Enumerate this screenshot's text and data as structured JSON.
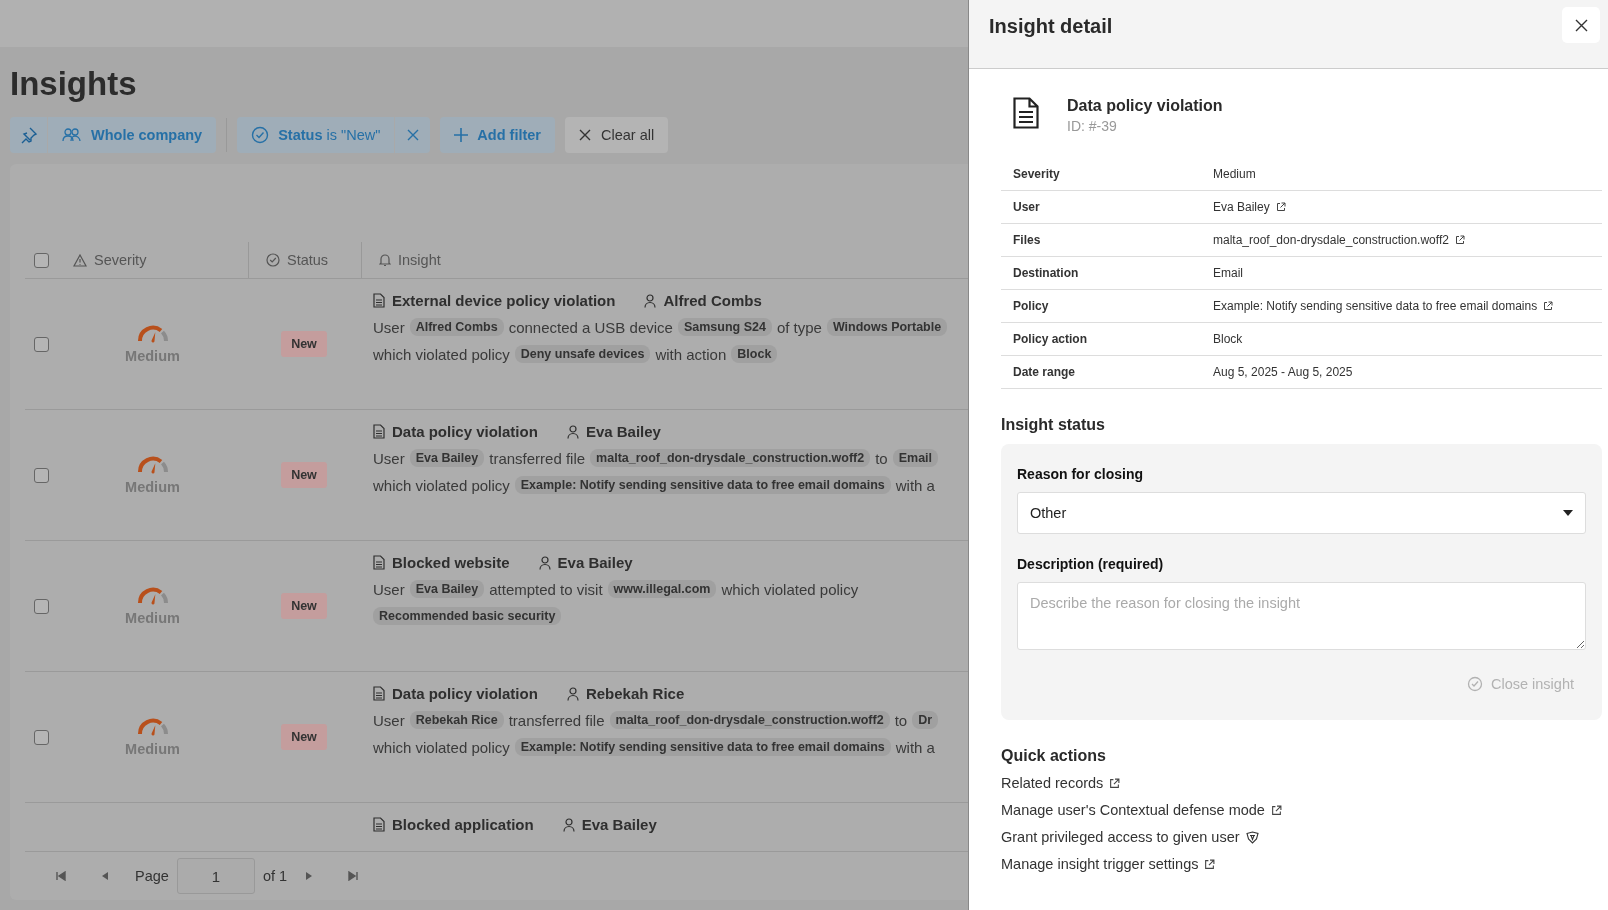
{
  "page_title": "Insights",
  "filter_bar": {
    "pinned": true,
    "scope": "Whole company",
    "status_filter": "**Status** is \"New\"",
    "add_filter": "Add filter",
    "clear_all": "Clear all"
  },
  "table": {
    "all_selected": false,
    "columns": [
      "Severity",
      "Status",
      "Insight"
    ],
    "rows": [
      {
        "selected": false,
        "severity": "Medium",
        "status": "New",
        "title": "External device policy violation",
        "user": "Alfred Combs",
        "lines": [
          [
            {
              "kind": "text",
              "text": "User"
            },
            {
              "kind": "chip",
              "text": "Alfred Combs"
            },
            {
              "kind": "text",
              "text": "connected a USB device"
            },
            {
              "kind": "chip",
              "text": "Samsung S24"
            },
            {
              "kind": "text",
              "text": "of type"
            },
            {
              "kind": "chip",
              "text": "Windows Portable"
            }
          ],
          [
            {
              "kind": "text",
              "text": "which violated policy"
            },
            {
              "kind": "chip",
              "text": "Deny unsafe devices"
            },
            {
              "kind": "text",
              "text": "with action"
            },
            {
              "kind": "chip",
              "text": "Block"
            }
          ]
        ]
      },
      {
        "selected": false,
        "severity": "Medium",
        "status": "New",
        "title": "Data policy violation",
        "user": "Eva Bailey",
        "lines": [
          [
            {
              "kind": "text",
              "text": "User"
            },
            {
              "kind": "chip",
              "text": "Eva Bailey"
            },
            {
              "kind": "text",
              "text": "transferred file"
            },
            {
              "kind": "chip",
              "text": "malta_roof_don-drysdale_construction.woff2"
            },
            {
              "kind": "text",
              "text": "to"
            },
            {
              "kind": "chip",
              "text": "Email"
            }
          ],
          [
            {
              "kind": "text",
              "text": "which violated policy"
            },
            {
              "kind": "chip",
              "text": "Example: Notify sending sensitive data to free email domains"
            },
            {
              "kind": "text",
              "text": "with a"
            }
          ]
        ]
      },
      {
        "selected": false,
        "severity": "Medium",
        "status": "New",
        "title": "Blocked website",
        "user": "Eva Bailey",
        "lines": [
          [
            {
              "kind": "text",
              "text": "User"
            },
            {
              "kind": "chip",
              "text": "Eva Bailey"
            },
            {
              "kind": "text",
              "text": "attempted to visit"
            },
            {
              "kind": "chip",
              "text": "www.illegal.com"
            },
            {
              "kind": "text",
              "text": "which violated policy"
            }
          ],
          [
            {
              "kind": "chip",
              "text": "Recommended basic security"
            }
          ]
        ]
      },
      {
        "selected": false,
        "severity": "Medium",
        "status": "New",
        "title": "Data policy violation",
        "user": "Rebekah Rice",
        "lines": [
          [
            {
              "kind": "text",
              "text": "User"
            },
            {
              "kind": "chip",
              "text": "Rebekah Rice"
            },
            {
              "kind": "text",
              "text": "transferred file"
            },
            {
              "kind": "chip",
              "text": "malta_roof_don-drysdale_construction.woff2"
            },
            {
              "kind": "text",
              "text": "to"
            },
            {
              "kind": "chip",
              "text": "Dr"
            }
          ],
          [
            {
              "kind": "text",
              "text": "which violated policy"
            },
            {
              "kind": "chip",
              "text": "Example: Notify sending sensitive data to free email domains"
            },
            {
              "kind": "text",
              "text": "with a"
            }
          ]
        ]
      }
    ],
    "partial_row": {
      "title": "Blocked application",
      "user": "Eva Bailey"
    }
  },
  "pagination": {
    "page_label": "Page",
    "page": "1",
    "of": "of 1"
  },
  "panel": {
    "title": "Insight detail",
    "insight": {
      "title": "Data policy violation",
      "id": "ID: #-39"
    },
    "details": [
      {
        "label": "Severity",
        "value": "Medium",
        "link": false
      },
      {
        "label": "User",
        "value": "Eva Bailey",
        "link": true
      },
      {
        "label": "Files",
        "value": "malta_roof_don-drysdale_construction.woff2",
        "link": true
      },
      {
        "label": "Destination",
        "value": "Email",
        "link": false
      },
      {
        "label": "Policy",
        "value": "Example: Notify sending sensitive data to free email domains",
        "link": true
      },
      {
        "label": "Policy action",
        "value": "Block",
        "link": false
      },
      {
        "label": "Date range",
        "value": "Aug 5, 2025 - Aug 5, 2025",
        "link": false
      }
    ],
    "status_section": {
      "heading": "Insight status",
      "reason_label": "Reason for closing",
      "reason_value": "Other",
      "description_label": "Description (required)",
      "description_placeholder": "Describe the reason for closing the insight",
      "close_button": "Close insight",
      "close_disabled": true
    },
    "quick_actions": {
      "heading": "Quick actions",
      "items": [
        {
          "label": "Related records",
          "kind": "external"
        },
        {
          "label": "Manage user's Contextual defense mode",
          "kind": "external"
        },
        {
          "label": "Grant privileged access to given user",
          "kind": "privileged"
        },
        {
          "label": "Manage insight trigger settings",
          "kind": "external"
        }
      ]
    }
  }
}
